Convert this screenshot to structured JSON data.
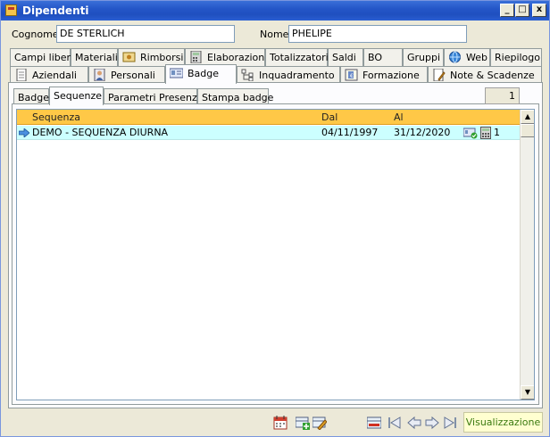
{
  "window": {
    "title": "Dipendenti",
    "controls": {
      "minimize": "_",
      "maximize": "□",
      "close": "x"
    }
  },
  "fields": {
    "cognome_label": "Cognome",
    "cognome_value": "DE STERLICH",
    "nome_label": "Nome",
    "nome_value": "PHELIPE"
  },
  "tabs_row1": [
    {
      "label": "Campi liberi"
    },
    {
      "label": "Materiali"
    },
    {
      "label": "Rimborsi",
      "icon": "money-icon"
    },
    {
      "label": "Elaborazioni",
      "icon": "calculator-icon"
    },
    {
      "label": "Totalizzatori"
    },
    {
      "label": "Saldi"
    },
    {
      "label": "BO"
    },
    {
      "label": "Gruppi"
    },
    {
      "label": "Web",
      "icon": "globe-icon"
    },
    {
      "label": "Riepilogo"
    }
  ],
  "tabs_row2": [
    {
      "label": "Aziendali",
      "icon": "document-icon"
    },
    {
      "label": "Personali",
      "icon": "person-icon"
    },
    {
      "label": "Badge",
      "icon": "badge-icon",
      "active": true
    },
    {
      "label": "Inquadramento",
      "icon": "hierarchy-icon"
    },
    {
      "label": "Formazione",
      "icon": "training-icon"
    },
    {
      "label": "Note & Scadenze",
      "icon": "notes-icon"
    }
  ],
  "subtabs": [
    {
      "label": "Badge"
    },
    {
      "label": "Sequenze",
      "active": true
    },
    {
      "label": "Parametri Presenze"
    },
    {
      "label": "Stampa badge"
    }
  ],
  "record_counter": "1",
  "grid": {
    "columns": [
      "Sequenza",
      "Dal",
      "Al"
    ],
    "rows": [
      {
        "sequenza": "DEMO - SEQUENZA DIURNA",
        "dal": "04/11/1997",
        "al": "31/12/2020",
        "count": "1"
      }
    ]
  },
  "statusbar": {
    "mode": "Visualizzazione",
    "icons": [
      "calendar-icon",
      "add-record-icon",
      "edit-record-icon",
      "delete-record-icon",
      "first-record-icon",
      "previous-record-icon",
      "next-record-icon",
      "last-record-icon"
    ]
  },
  "colors": {
    "header": "#ffc847",
    "selected_row": "#ccffff",
    "mode_text": "#3a7a10"
  }
}
